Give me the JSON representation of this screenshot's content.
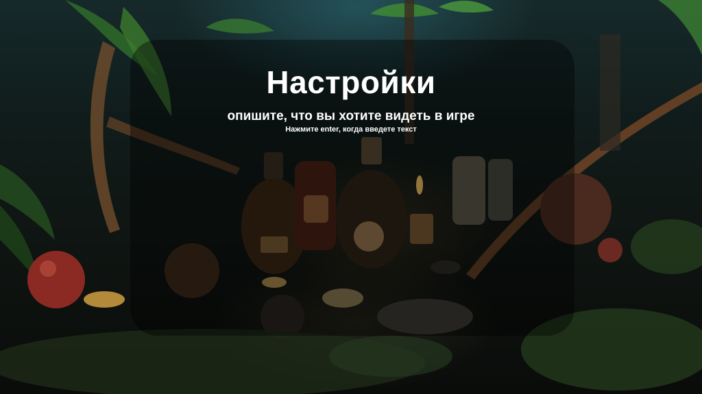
{
  "settings": {
    "title": "Настройки",
    "prompt": "опишите, что вы хотите видеть в игре",
    "hint": "Нажмите enter, когда введете текст",
    "input_value": ""
  },
  "background": {
    "description_icon": "alchemy-table-scene",
    "accent_color": "#2a6a6e"
  }
}
